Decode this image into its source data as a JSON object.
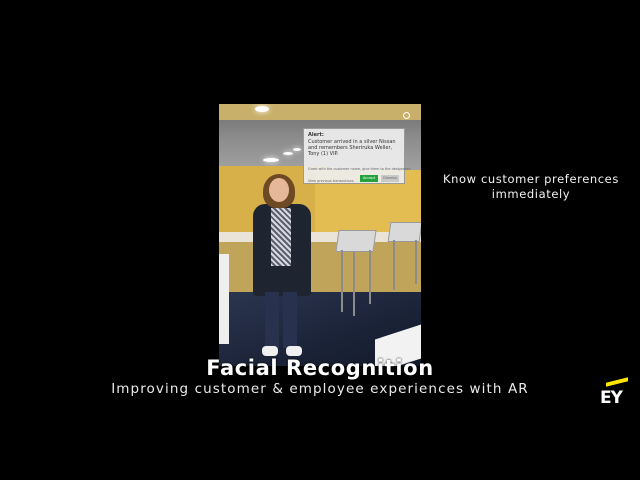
{
  "ar_alert": {
    "title": "Alert:",
    "body": "Customer arrived in a silver Nissan and remembers Sheriruka Weller, Tony (1) VIP.",
    "note": "Greet with the customer name, give them to the designated",
    "link": "View previous transactions",
    "accept_label": "Accept",
    "dismiss_label": "Dismiss"
  },
  "side_caption": "Know customer preferences immediately",
  "title": "Facial Recognition",
  "subtitle": "Improving customer & employee experiences with AR",
  "logo": {
    "text": "EY",
    "accent_color": "#ffe600"
  },
  "colors": {
    "background": "#000000",
    "accept_button": "#22a23a"
  }
}
